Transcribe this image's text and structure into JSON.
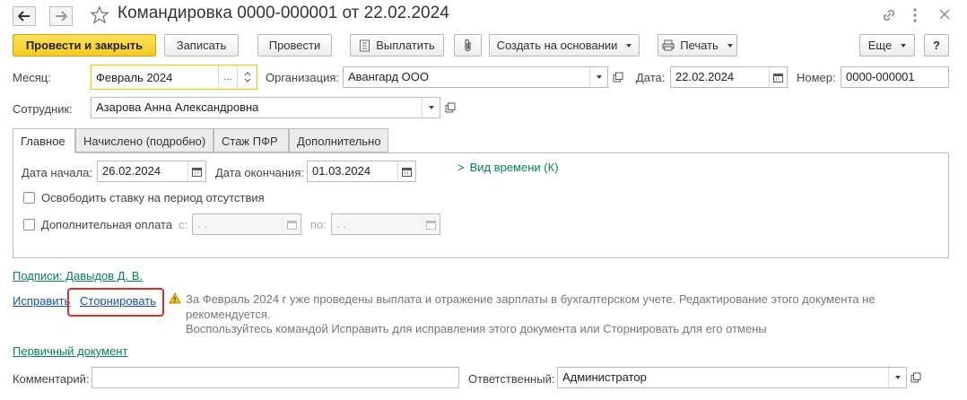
{
  "window": {
    "title": "Командировка 0000-000001 от 22.02.2024"
  },
  "toolbar": {
    "post_close": "Провести и закрыть",
    "save": "Записать",
    "post": "Провести",
    "pay": "Выплатить",
    "create_based": "Создать на основании",
    "print": "Печать",
    "more": "Еще",
    "help": "?"
  },
  "header": {
    "month_label": "Месяц:",
    "month_value": "Февраль 2024",
    "org_label": "Организация:",
    "org_value": "Авангард ООО",
    "date_label": "Дата:",
    "date_value": "22.02.2024",
    "number_label": "Номер:",
    "number_value": "0000-000001",
    "employee_label": "Сотрудник:",
    "employee_value": "Азарова Анна Александровна"
  },
  "tabs": [
    {
      "label": "Главное"
    },
    {
      "label": "Начислено (подробно)"
    },
    {
      "label": "Стаж ПФР"
    },
    {
      "label": "Дополнительно"
    }
  ],
  "main": {
    "start_label": "Дата начала:",
    "start_value": "26.02.2024",
    "end_label": "Дата окончания:",
    "end_value": "01.03.2024",
    "time_view": "Вид времени (К)",
    "release_rate": "Освободить ставку на период отсутствия",
    "extra_pay": "Дополнительная оплата",
    "from_label": "с:",
    "from_value": " .  .",
    "to_label": "по:",
    "to_value": " .  ."
  },
  "footer": {
    "signatures": "Подписи: Давыдов Д. В.",
    "fix": "Исправить",
    "reverse": "Сторнировать",
    "warning_line1": "За Февраль 2024 г уже проведены выплата и отражение зарплаты в бухгалтерском учете. Редактирование этого документа не",
    "warning_line2": "рекомендуется.",
    "warning_line3": "Воспользуйтесь командой Исправить для исправления этого документа или Сторнировать для его отмены",
    "primary_doc": "Первичный документ",
    "comment_label": "Комментарий:",
    "comment_value": "",
    "responsible_label": "Ответственный:",
    "responsible_value": "Администратор"
  },
  "colors": {
    "accent_yellow": "#f5cc21",
    "link_green": "#0a7f5b",
    "link_blue": "#1a52a8",
    "highlight_red": "#d9302c"
  }
}
